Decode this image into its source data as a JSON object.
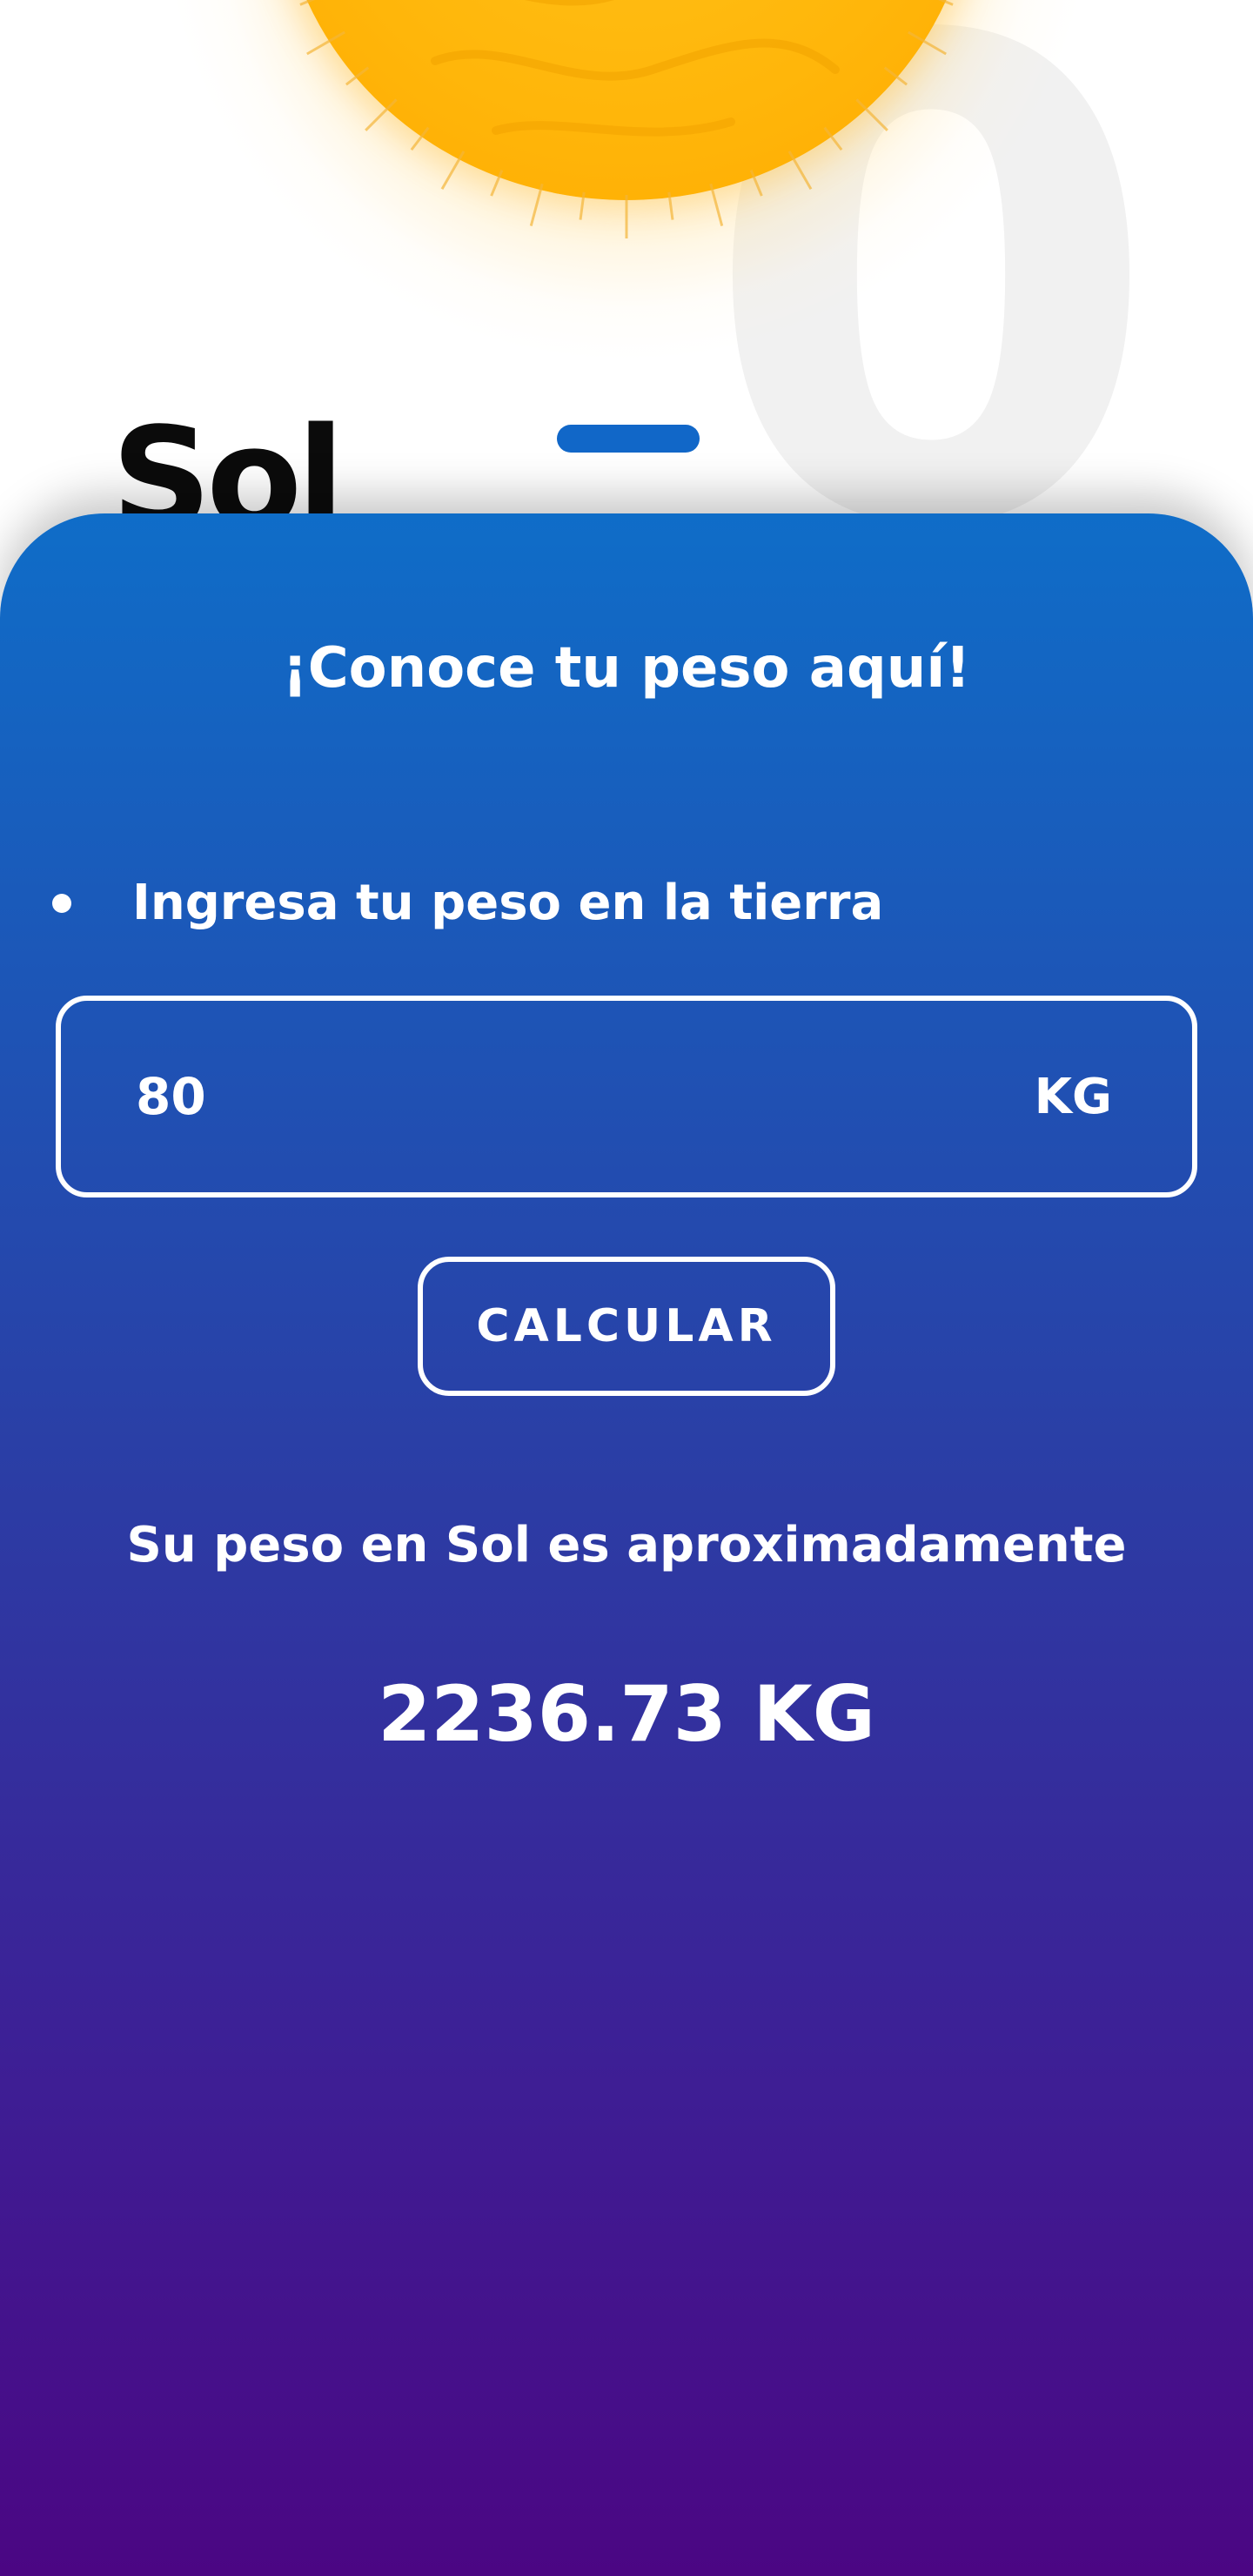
{
  "header": {
    "planet_name": "Sol",
    "background_digit": "0"
  },
  "sheet": {
    "title": "¡Conoce tu peso aquí!",
    "instruction": "Ingresa tu peso en la tierra",
    "weight_input": {
      "value": "80",
      "unit": "KG"
    },
    "calculate_button_label": "CALCULAR",
    "result_label": "Su peso en Sol es aproximadamente",
    "result_value": "2236.73 KG"
  },
  "colors": {
    "sun": "#ffb60a",
    "handle": "#1167c8",
    "gradient_top": "#0f6dc8",
    "gradient_bottom": "#4b0683"
  },
  "icons": {
    "sun": "sun-illustration",
    "bullet": "bullet-dot"
  }
}
